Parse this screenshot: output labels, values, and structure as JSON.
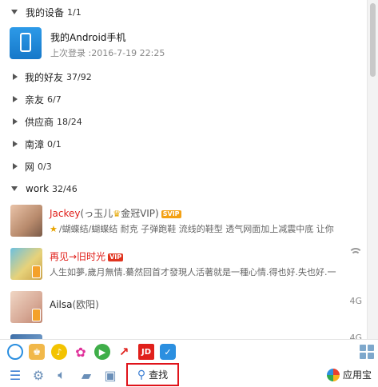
{
  "groups": {
    "my_devices": {
      "name": "我的设备",
      "count": "1/1"
    },
    "friends": {
      "name": "我的好友",
      "count": "37/92"
    },
    "relatives": {
      "name": "亲友",
      "count": "6/7"
    },
    "suppliers": {
      "name": "供应商",
      "count": "18/24"
    },
    "nanzhang": {
      "name": "南漳",
      "count": "0/1"
    },
    "net": {
      "name": "网",
      "count": "0/3"
    },
    "work": {
      "name": "work",
      "count": "32/46"
    }
  },
  "device": {
    "name": "我的Android手机",
    "last_login": "上次登录 :2016-7-19 22:25"
  },
  "contacts": [
    {
      "nick": "Jackey",
      "remark": "(っ玉儿",
      "remark2": "金冠VIP)",
      "badge": "SVIP",
      "signature": "/蝴蝶结/蝴蝶结 耐克 子弹跑鞋 流线的鞋型 透气网面加上减震中底 让你"
    },
    {
      "nick": "再见→旧时光",
      "badge": "VIP",
      "signature": "人生如夢,歲月無情.驀然回首才發現人活著就是一種心情.得也好.失也好.一"
    },
    {
      "nick": "Ailsa",
      "remark": "(欧阳)",
      "status": "4G"
    },
    {
      "status": "4G"
    }
  ],
  "toolbar": {
    "find_label": "查找",
    "appstore_label": "应用宝"
  },
  "colors": {
    "accent": "#3c7fd3",
    "highlight_border": "#e0131a",
    "vip_name": "#e0201b"
  }
}
